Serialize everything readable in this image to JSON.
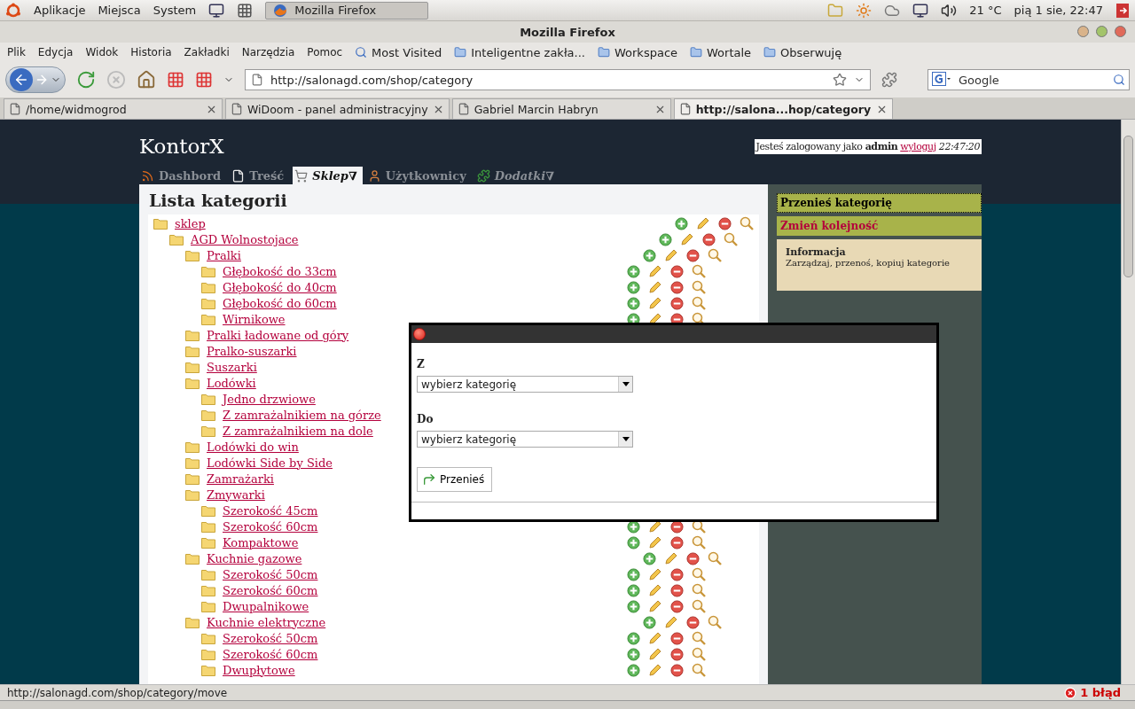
{
  "desktop_panel": {
    "menus": [
      "Aplikacje",
      "Miejsca",
      "System"
    ],
    "taskbar": [
      {
        "label": "Mozilla Firefox",
        "selected": true
      }
    ],
    "weather": "21 °C",
    "clock": "pią  1 sie, 22:47"
  },
  "window": {
    "title": "Mozilla Firefox"
  },
  "menu_bar": [
    "Plik",
    "Edycja",
    "Widok",
    "Historia",
    "Zakładki",
    "Narzędzia",
    "Pomoc"
  ],
  "bookmarks": [
    "Most Visited",
    "Inteligentne zakła...",
    "Workspace",
    "Wortale",
    "Obserwuję"
  ],
  "address_bar": {
    "value": "http://salonagd.com/shop/category"
  },
  "search_bar": {
    "placeholder": "Google"
  },
  "browser_tabs": [
    {
      "label": "/home/widmogrod",
      "selected": false
    },
    {
      "label": "WiDoom - panel administracyjny",
      "selected": false
    },
    {
      "label": "Gabriel Marcin Habryn",
      "selected": false
    },
    {
      "label": "http://salona...hop/category",
      "selected": true
    }
  ],
  "page": {
    "site_title": "KontorX",
    "login": {
      "text": "Jesteś zalogowany jako **admin**",
      "link": "wyloguj",
      "time": "22:47:20"
    },
    "nav": [
      {
        "label": "Dashbord",
        "kind": "link",
        "selected": false
      },
      {
        "label": "Treść",
        "kind": "link",
        "selected": false
      },
      {
        "label": "Sklep∇",
        "kind": "dropdown",
        "selected": true
      },
      {
        "label": "Użytkownicy",
        "kind": "link",
        "selected": false
      },
      {
        "label": "Dodatki∇",
        "kind": "dropdown",
        "selected": false
      }
    ],
    "heading": "Lista kategorii",
    "categories": [
      {
        "label": "sklep",
        "children": [
          {
            "label": "AGD Wolnostojace",
            "children": [
              {
                "label": "Pralki",
                "children": [
                  {
                    "label": "Głębokość do 33cm"
                  },
                  {
                    "label": "Głębokość do 40cm"
                  },
                  {
                    "label": "Głębokość do 60cm"
                  },
                  {
                    "label": "Wirnikowe"
                  }
                ]
              },
              {
                "label": "Pralki ładowane od góry"
              },
              {
                "label": "Pralko-suszarki"
              },
              {
                "label": "Suszarki"
              },
              {
                "label": "Lodówki",
                "children": [
                  {
                    "label": "Jedno drzwiowe"
                  },
                  {
                    "label": "Z zamrażalnikiem na górze"
                  },
                  {
                    "label": "Z zamrażalnikiem na dole"
                  }
                ]
              },
              {
                "label": "Lodówki do win"
              },
              {
                "label": "Lodówki Side by Side"
              },
              {
                "label": "Zamrażarki"
              },
              {
                "label": "Zmywarki",
                "children": [
                  {
                    "label": "Szerokość 45cm"
                  },
                  {
                    "label": "Szerokość 60cm"
                  },
                  {
                    "label": "Kompaktowe"
                  }
                ]
              },
              {
                "label": "Kuchnie gazowe",
                "children": [
                  {
                    "label": "Szerokość 50cm"
                  },
                  {
                    "label": "Szerokość 60cm"
                  },
                  {
                    "label": "Dwupalnikowe"
                  }
                ]
              },
              {
                "label": "Kuchnie elektryczne",
                "children": [
                  {
                    "label": "Szerokość 50cm"
                  },
                  {
                    "label": "Szerokość 60cm"
                  },
                  {
                    "label": "Dwupłytowe"
                  }
                ]
              }
            ]
          }
        ]
      }
    ],
    "sidebar": {
      "actions": [
        {
          "label": "Przenieś kategorię",
          "selected": true
        },
        {
          "label": "Zmień kolejność",
          "selected": false
        }
      ],
      "info": {
        "title": "Informacja",
        "text": "Zarządzaj, przenoś, kopiuj kategorie"
      }
    }
  },
  "dialog": {
    "fields": [
      {
        "label": "Z",
        "value": "wybierz kategorię"
      },
      {
        "label": "Do",
        "value": "wybierz kategorię"
      }
    ],
    "button": "Przenieś"
  },
  "status_bar": {
    "url": "http://salonagd.com/shop/category/move",
    "errors": "1 błąd"
  }
}
